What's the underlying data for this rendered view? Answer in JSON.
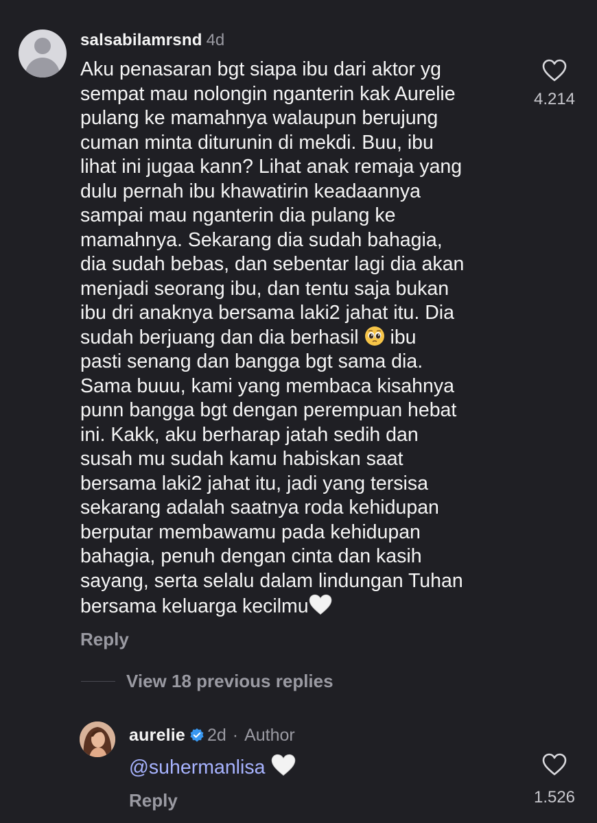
{
  "comment": {
    "username": "salsabilamrsnd",
    "time": "4d",
    "text_before_emoji": "Aku penasaran bgt siapa ibu dari aktor yg\nsempat mau nolongin nganterin kak Aurelie\npulang ke mamahnya walaupun berujung\ncuman minta diturunin di mekdi. Buu, ibu\nlihat ini jugaa kann? Lihat anak remaja yang\ndulu pernah ibu khawatirin keadaannya\nsampai mau nganterin dia pulang ke\nmamahnya. Sekarang dia sudah bahagia,\ndia sudah bebas, dan sebentar lagi dia akan\nmenjadi seorang ibu, dan tentu saja bukan\nibu dri anaknya bersama laki2 jahat itu. Dia\nsudah berjuang dan dia berhasil ",
    "emoji_1": "pleading-face-emoji",
    "text_after_emoji": " ibu\npasti senang dan bangga bgt sama dia.\nSama buuu, kami yang membaca kisahnya\npunn bangga bgt dengan perempuan hebat\nini. Kakk, aku berharap jatah sedih dan\nsusah mu sudah kamu habiskan saat\nbersama laki2 jahat itu, jadi yang tersisa\nsekarang adalah saatnya roda kehidupan\nberputar membawamu pada kehidupan\nbahagia, penuh dengan cinta dan kasih\nsayang, serta selalu dalam lindungan Tuhan\nbersama keluarga kecilmu",
    "emoji_2": "white-heart-emoji",
    "reply_label": "Reply",
    "like_count": "4.214",
    "icon": "heart-outline-icon"
  },
  "view_replies": {
    "label": "View 18 previous replies"
  },
  "reply": {
    "username": "aurelie",
    "verified_icon": "verified-badge-icon",
    "time": "2d",
    "separator": "·",
    "author_tag": "Author",
    "mention": "@suhermanlisa",
    "emoji": "white-heart-emoji",
    "reply_label": "Reply",
    "like_count": "1.526",
    "icon": "heart-outline-icon"
  },
  "colors": {
    "background": "#1f1f24",
    "primary_text": "#f5f5f5",
    "secondary_text": "#9a9aa2",
    "mention": "#a7b3ff",
    "verified": "#3897f0"
  }
}
